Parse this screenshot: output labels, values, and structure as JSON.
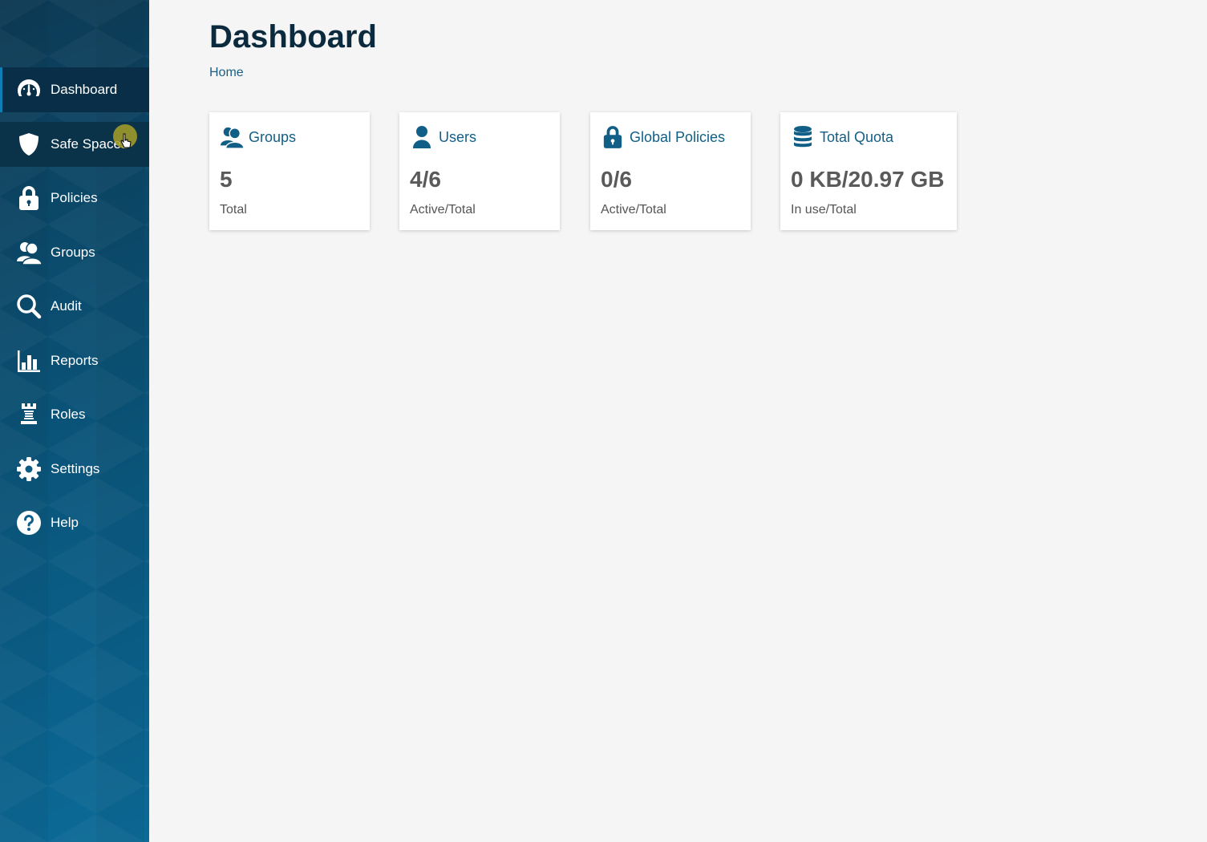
{
  "sidebar": {
    "items": [
      {
        "label": "Dashboard",
        "icon": "gauge-icon",
        "active": true
      },
      {
        "label": "Safe Spaces",
        "icon": "shield-icon"
      },
      {
        "label": "Policies",
        "icon": "lock-icon"
      },
      {
        "label": "Groups",
        "icon": "users-icon"
      },
      {
        "label": "Audit",
        "icon": "magnifier-icon"
      },
      {
        "label": "Reports",
        "icon": "bar-chart-icon"
      },
      {
        "label": "Roles",
        "icon": "chess-rook-icon"
      },
      {
        "label": "Settings",
        "icon": "gear-icon"
      },
      {
        "label": "Help",
        "icon": "question-circle-icon"
      }
    ]
  },
  "page": {
    "title": "Dashboard",
    "breadcrumb": "Home"
  },
  "cards": [
    {
      "title": "Groups",
      "icon": "users-icon",
      "value": "5",
      "caption": "Total"
    },
    {
      "title": "Users",
      "icon": "user-icon",
      "value": "4/6",
      "caption": "Active/Total"
    },
    {
      "title": "Global Policies",
      "icon": "lock-icon",
      "value": "0/6",
      "caption": "Active/Total"
    },
    {
      "title": "Total Quota",
      "icon": "database-icon",
      "value": "0 KB/20.97 GB",
      "caption": "In use/Total"
    }
  ],
  "colors": {
    "accent": "#115f86",
    "sidebar_dark": "#0c3a55",
    "sidebar_light": "#0b6a97",
    "page_bg": "#f4f5f4",
    "title": "#0b2a3d"
  }
}
